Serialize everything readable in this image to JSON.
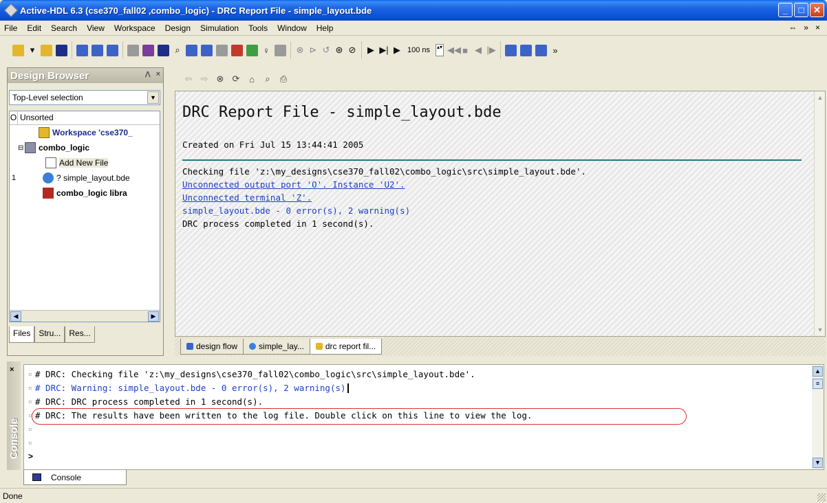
{
  "window": {
    "title": "Active-HDL 6.3 (cse370_fall02 ,combo_logic) - DRC Report File - simple_layout.bde",
    "minimize": "_",
    "maximize": "□",
    "close": "✕"
  },
  "menu": {
    "items": [
      "File",
      "Edit",
      "Search",
      "View",
      "Workspace",
      "Design",
      "Simulation",
      "Tools",
      "Window",
      "Help"
    ],
    "right_controls": [
      "⇔",
      "»",
      "×"
    ]
  },
  "toolbar": {
    "sim_time": "100 ns",
    "icons": [
      "new-workspace-icon",
      "open-icon",
      "save-icon",
      "compile-icon",
      "run-icon",
      "stop-icon"
    ]
  },
  "design_browser": {
    "title": "Design Browser",
    "pin": "ᐱ",
    "close": "×",
    "filter_selected": "Top-Level selection",
    "tree_header": {
      "col0": "O",
      "col1": "Unsorted"
    },
    "rows": [
      {
        "num": "",
        "label": "Workspace 'cse370_",
        "bold": true,
        "icon": "workspace-icon"
      },
      {
        "num": "",
        "label": "combo_logic",
        "bold": true,
        "icon": "design-icon"
      },
      {
        "num": "",
        "label": "Add New File",
        "bold": false,
        "icon": "add-file-icon"
      },
      {
        "num": "1",
        "label": "? simple_layout.bde",
        "bold": false,
        "icon": "bde-file-icon"
      },
      {
        "num": "",
        "label": "combo_logic libra",
        "bold": true,
        "icon": "library-icon"
      }
    ],
    "tabs": [
      "Files",
      "Stru...",
      "Res..."
    ]
  },
  "document": {
    "title": "DRC Report File - simple_layout.bde",
    "created": "Created on Fri Jul 15 13:44:41 2005",
    "lines": [
      {
        "text": "Checking file 'z:\\my_designs\\cse370_fall02\\combo_logic\\src\\simple_layout.bde'.",
        "style": "plain"
      },
      {
        "text": "Unconnected output port 'O'. Instance 'U2'.",
        "style": "link"
      },
      {
        "text": "Unconnected terminal 'Z'.",
        "style": "link"
      },
      {
        "text": "simple_layout.bde - 0 error(s), 2 warning(s)",
        "style": "blue"
      },
      {
        "text": "DRC process completed in 1 second(s).",
        "style": "plain"
      }
    ],
    "tabs": [
      "design flow",
      "simple_lay...",
      "drc report fil..."
    ]
  },
  "console": {
    "label": "Console",
    "close": "×",
    "lines": [
      {
        "text": "# DRC: Checking file 'z:\\my_designs\\cse370_fall02\\combo_logic\\src\\simple_layout.bde'.",
        "style": "plain"
      },
      {
        "text": "# DRC: Warning: simple_layout.bde - 0 error(s), 2 warning(s)",
        "style": "blue"
      },
      {
        "text": "# DRC: DRC process completed in 1 second(s).",
        "style": "plain"
      },
      {
        "text": "# DRC: The results have been written to the log file. Double click on this line to view the log.",
        "style": "plain"
      },
      {
        "text": "",
        "style": "plain"
      },
      {
        "text": "",
        "style": "plain"
      }
    ],
    "prompt": ">",
    "tab_label": "Console"
  },
  "status": {
    "text": "Done"
  },
  "colors": {
    "link": "#1d3fc8",
    "rule": "#1f7a7a",
    "highlight": "#d6352a",
    "titlebar": "#0b4fd6"
  }
}
